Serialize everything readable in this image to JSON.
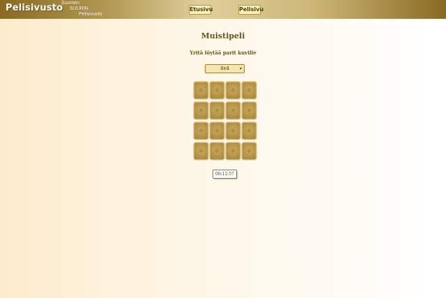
{
  "header": {
    "logo": "Pelisivusto",
    "tagline": [
      "Suomen",
      "SUURIN",
      "Pelisivusto"
    ],
    "nav": [
      {
        "label": "Etusivu"
      },
      {
        "label": "Pelisivu"
      }
    ]
  },
  "game": {
    "title": "Muistipeli",
    "subtitle": "Yritä löytää parit kuville",
    "board_size": "4x4",
    "grid": {
      "rows": 4,
      "cols": 4
    },
    "timer": "00:12:57"
  },
  "colors": {
    "header_gold": "#b39a55",
    "card_back": "#b89648",
    "text_brown": "#6a5418"
  }
}
